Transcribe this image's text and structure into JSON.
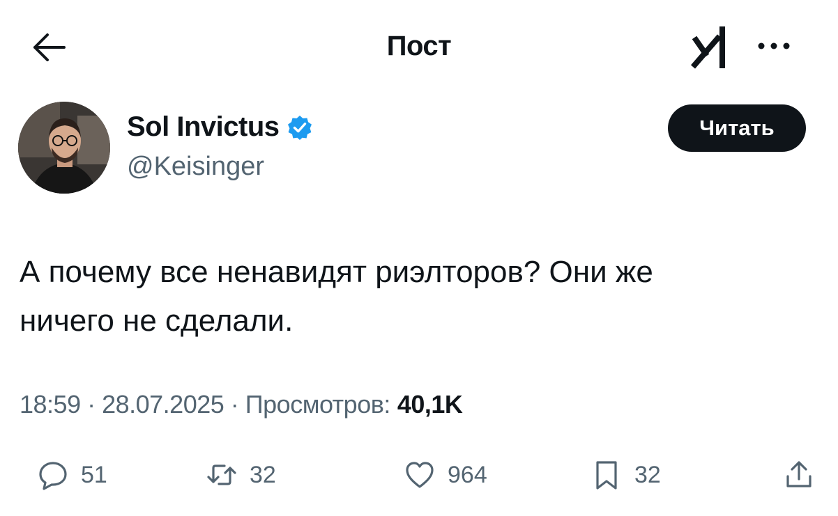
{
  "header": {
    "back_icon": "arrow-left-icon",
    "title": "Пост",
    "grok_icon": "grok-logo-icon",
    "more_icon": "more-horizontal-icon"
  },
  "author": {
    "name": "Sol Invictus",
    "handle": "@Keisinger",
    "verified": true,
    "verified_color": "#1d9bf0"
  },
  "read_button": {
    "label": "Читать"
  },
  "tweet": {
    "line1": "А почему все ненавидят риэлторов? Они же",
    "line2": "ничего не сделали."
  },
  "meta": {
    "time": "18:59",
    "date": "28.07.2025",
    "views_label": "Просмотров:",
    "views": "40,1K"
  },
  "actions": {
    "replies": "51",
    "retweets": "32",
    "likes": "964",
    "bookmarks": "32"
  },
  "colors": {
    "text": "#0f1419",
    "secondary": "#536471",
    "button_bg": "#0f1419"
  }
}
